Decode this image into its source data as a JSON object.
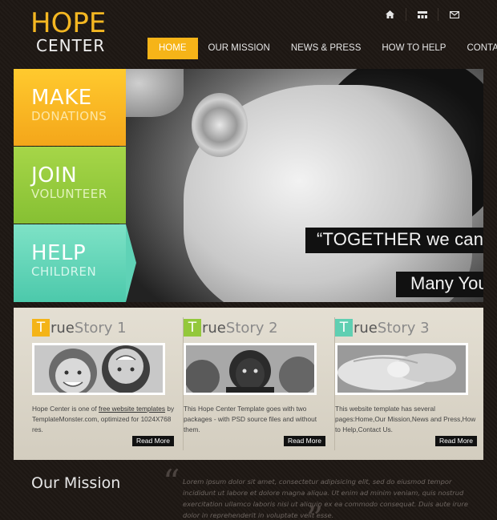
{
  "logo": {
    "line1": "HOPE",
    "line2": "CENTER"
  },
  "top_icons": [
    "home-icon",
    "sitemap-icon",
    "mail-icon"
  ],
  "nav": [
    "HOME",
    "OUR MISSION",
    "NEWS & PRESS",
    "HOW TO HELP",
    "CONTACT"
  ],
  "hero": {
    "quote_line1": "“TOGETHER we can CHANGE",
    "quote_line2": "Many Young LIVES”",
    "tiles": [
      {
        "big": "MAKE",
        "small": "DONATIONS",
        "color": "#f8b821"
      },
      {
        "big": "JOIN",
        "small": "VOLUNTEER",
        "color": "#96cb3e"
      },
      {
        "big": "HELP",
        "small": "CHILDREN",
        "color": "#62d2b6"
      }
    ]
  },
  "stories": [
    {
      "badge": "T",
      "rest": "rue",
      "word": "Story 1",
      "badge_color": "#f4b418",
      "text_1": "Hope Center is one of ",
      "link": "free website templates",
      "text_2": " by TemplateMonster.com, optimized for 1024X768 res.",
      "more": "Read More"
    },
    {
      "badge": "T",
      "rest": "rue",
      "word": "Story 2",
      "badge_color": "#93c83b",
      "text": "This Hope Center Template goes with two packages - with PSD source files and without them.",
      "more": "Read More"
    },
    {
      "badge": "T",
      "rest": "rue",
      "word": "Story 3",
      "badge_color": "#5fcfb2",
      "text": "This website template has several pages:Home,Our Mission,News and Press,How to Help,Contact Us.",
      "more": "Read More"
    }
  ],
  "mission": {
    "title": "Our Mission",
    "text": "Lorem ipsum dolor sit amet, consectetur adipisicing elit, sed do eiusmod tempor incididunt ut labore et dolore magna aliqua. Ut enim ad minim veniam, quis nostrud exercitation ullamco laboris nisi ut aliquip ex ea commodo consequat. Duis aute irure dolor in reprehenderit in voluptate velit esse."
  }
}
